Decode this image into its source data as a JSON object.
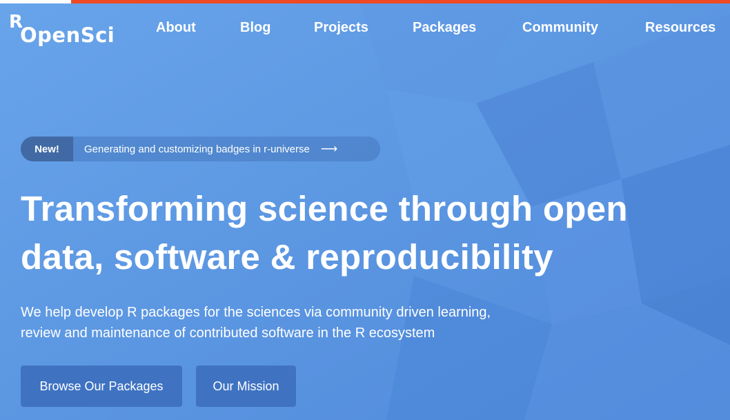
{
  "brand": {
    "logo_r": "R",
    "logo_text": "OpenSci",
    "accent": "#ef4a23",
    "background": "#5f9ce6",
    "button_color": "#3f73c2"
  },
  "nav": {
    "items": [
      {
        "label": "About"
      },
      {
        "label": "Blog"
      },
      {
        "label": "Projects"
      },
      {
        "label": "Packages"
      },
      {
        "label": "Community"
      },
      {
        "label": "Resources"
      }
    ]
  },
  "announcement": {
    "tag": "New!",
    "text": "Generating and customizing badges in r-universe",
    "arrow_icon": "arrow-right-icon",
    "arrow_glyph": "⟶"
  },
  "hero": {
    "title_line1": "Transforming science through open",
    "title_line2": "data, software & reproducibility",
    "subtitle_line1": "We help develop R packages for the sciences via community driven learning,",
    "subtitle_line2": "review and maintenance of contributed software in the R ecosystem"
  },
  "buttons": {
    "browse": "Browse Our Packages",
    "mission": "Our Mission"
  }
}
